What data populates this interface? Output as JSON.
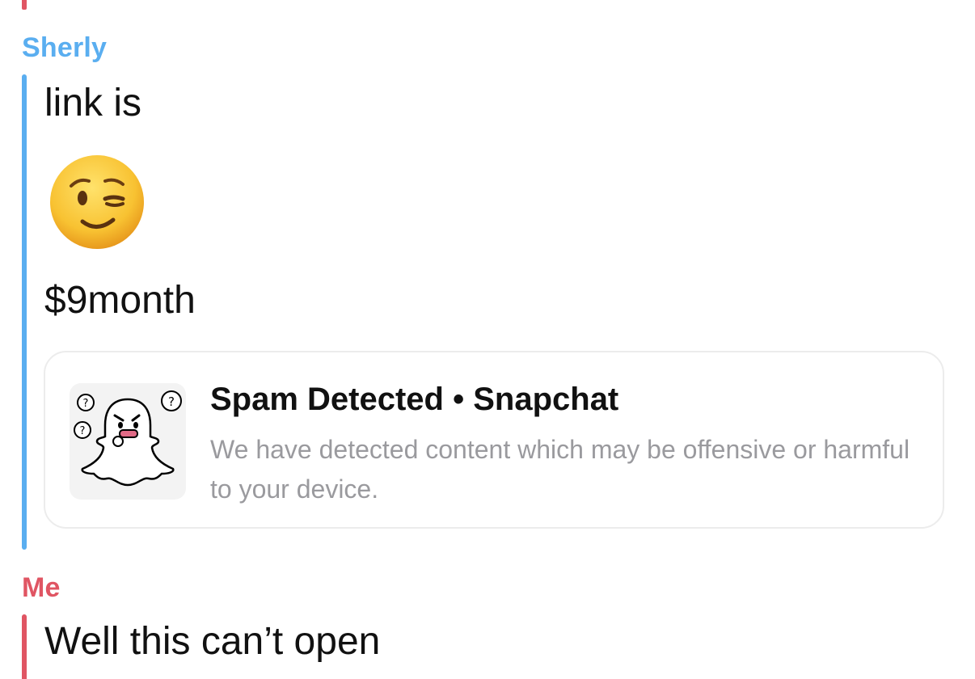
{
  "colors": {
    "sherly_accent": "#5aaef0",
    "me_accent": "#e05563",
    "text": "#111111",
    "muted": "#9a9a9e"
  },
  "messages": {
    "sherly": {
      "sender": "Sherly",
      "line1": "link is",
      "emoji": "winking-face",
      "line2": "$9month",
      "preview": {
        "title": "Spam Detected • Snapchat",
        "description": "We have detected content which may be offensive or harmful to your device.",
        "thumbnail_icon": "confused-ghost-icon"
      }
    },
    "me": {
      "sender": "Me",
      "text": "Well this can’t open"
    }
  }
}
